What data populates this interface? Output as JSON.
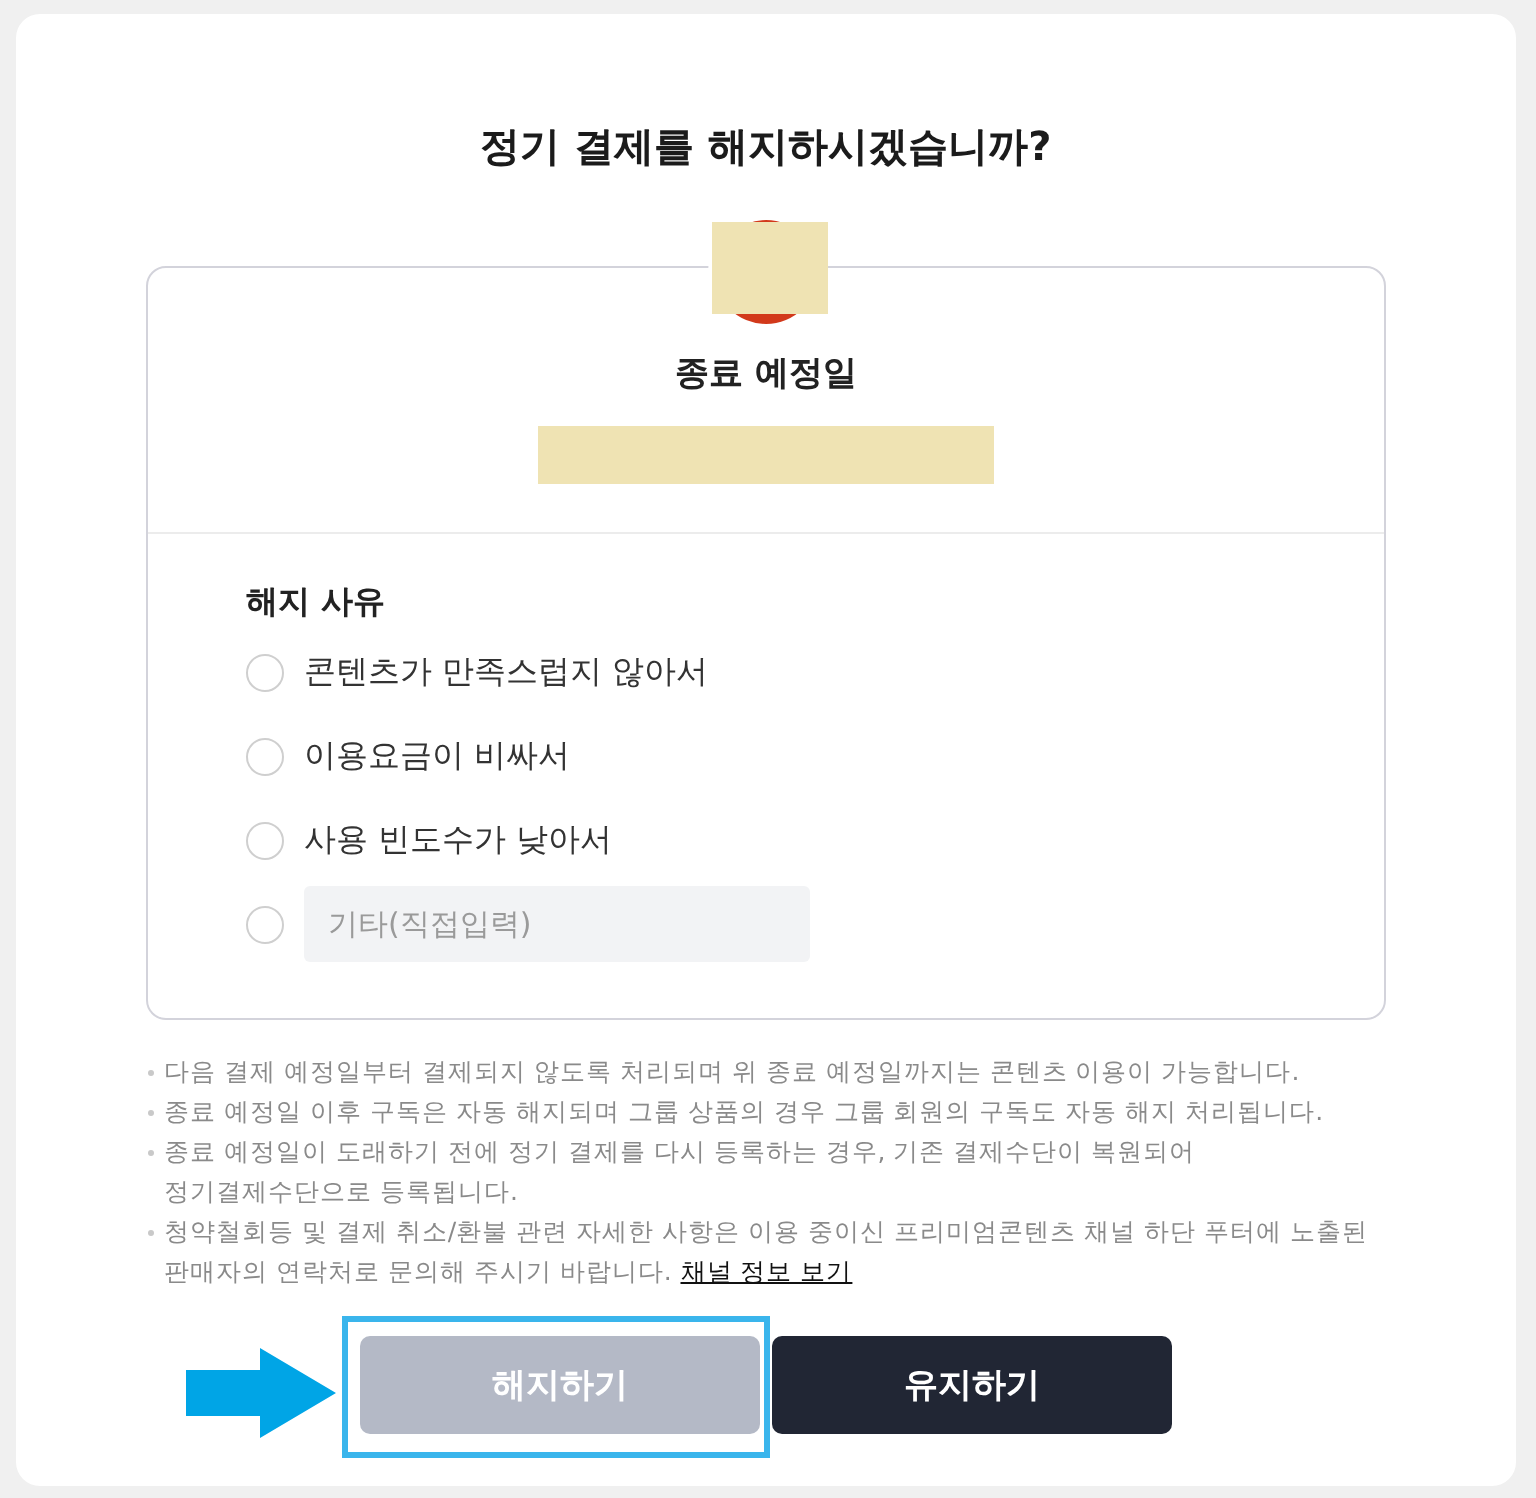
{
  "title": "정기 결제를 해지하시겠습니까?",
  "end_date": {
    "label": "종료 예정일"
  },
  "reasons": {
    "heading": "해지 사유",
    "options": [
      {
        "kind": "text",
        "label": "콘텐츠가 만족스럽지 않아서",
        "selected": false
      },
      {
        "kind": "text",
        "label": "이용요금이 비싸서",
        "selected": false
      },
      {
        "kind": "text",
        "label": "사용 빈도수가 낮아서",
        "selected": false
      },
      {
        "kind": "input",
        "placeholder": "기타(직접입력)",
        "selected": false
      }
    ]
  },
  "notes": [
    {
      "text": "다음 결제 예정일부터 결제되지 않도록 처리되며 위 종료 예정일까지는 콘텐츠 이용이 가능합니다."
    },
    {
      "text": "종료 예정일 이후 구독은 자동 해지되며 그룹 상품의 경우 그룹 회원의 구독도 자동 해지 처리됩니다."
    },
    {
      "text": "종료 예정일이 도래하기 전에 정기 결제를 다시 등록하는 경우, 기존 결제수단이 복원되어\n정기결제수단으로 등록됩니다."
    },
    {
      "text": "청약철회등 및 결제 취소/환불 관련 자세한 사항은 이용 중이신 프리미엄콘텐츠 채널 하단 푸터에 노출된\n판매자의 연락처로 문의해 주시기 바랍니다.",
      "link": "채널 정보 보기"
    }
  ],
  "buttons": [
    {
      "label": "해지하기",
      "kind": "secondary",
      "highlighted": true
    },
    {
      "label": "유지하기",
      "kind": "primary",
      "highlighted": false
    }
  ]
}
